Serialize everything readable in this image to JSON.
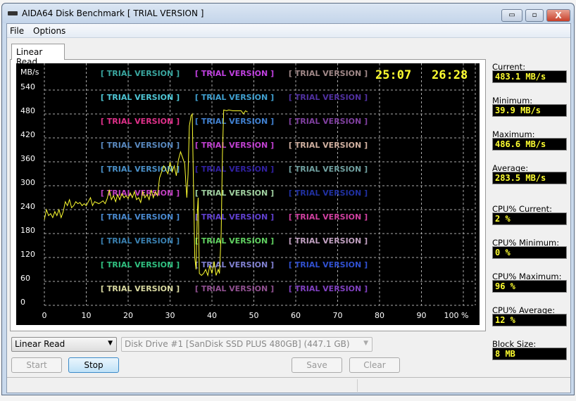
{
  "window": {
    "title": "AIDA64 Disk Benchmark  [ TRIAL VERSION ]",
    "minimize": "▭",
    "maximize": "▫",
    "close": "X"
  },
  "menu": [
    "File",
    "Options"
  ],
  "tab": "Linear Read",
  "chart": {
    "times": [
      "25:07",
      "26:28"
    ],
    "watermark": "[ TRIAL VERSION ]",
    "watermark_colors": [
      [
        "#3aa7a0",
        "#c040e0",
        "#a08888"
      ],
      [
        "#4fc7d6",
        "#40a0d0",
        "#5030a0"
      ],
      [
        "#e0308a",
        "#4080d0",
        "#8040a0"
      ],
      [
        "#5a8ac0",
        "#c040d0",
        "#d0b0a0"
      ],
      [
        "#4a90c8",
        "#3020a0",
        "#70a0a0"
      ],
      [
        "#c040c0",
        "#a0d0a0",
        "#2030a0"
      ],
      [
        "#4a8ad0",
        "#6040d0",
        "#d040a0"
      ],
      [
        "#3a80b0",
        "#60d060",
        "#c0a0c0"
      ],
      [
        "#30c080",
        "#8080d0",
        "#3050d0"
      ],
      [
        "#d8d8a0",
        "#905090",
        "#8040c0"
      ]
    ]
  },
  "chart_data": {
    "type": "line",
    "ylabel": "MB/s",
    "xlabel": "%",
    "xlim": [
      0,
      100
    ],
    "ylim": [
      0,
      540
    ],
    "x_ticks": [
      "0",
      "10",
      "20",
      "30",
      "40",
      "50",
      "60",
      "70",
      "80",
      "90",
      "100 %"
    ],
    "y_ticks": [
      "0",
      "60",
      "120",
      "180",
      "240",
      "300",
      "360",
      "420",
      "480",
      "540"
    ],
    "grid": true,
    "line_color": "#ffff30",
    "series": [
      {
        "x": [
          0,
          0.5,
          1,
          1.5,
          2,
          2.5,
          3,
          3.5,
          4,
          4.5,
          5,
          5.5,
          6,
          6.5,
          7,
          7.5,
          8,
          8.5,
          9,
          9.5,
          10,
          10.5,
          11,
          11.5,
          12,
          13,
          14,
          14.5,
          15,
          15.5,
          16,
          16.5,
          17,
          17.5,
          18,
          18.5,
          19,
          19.5,
          20,
          20.5,
          21,
          21.5,
          22,
          22.5,
          23,
          23.5,
          24,
          24.5,
          25,
          25.5,
          26,
          26.5,
          27,
          27.5,
          28,
          28.5,
          29,
          29.5,
          30,
          30.5,
          31,
          31.5,
          32,
          32.5,
          33,
          33.5,
          34,
          34.3,
          34.6,
          35,
          35.3,
          35.6,
          35.9,
          36.2,
          36.5,
          36.7,
          37,
          37.5,
          38,
          38.5,
          39,
          39.5,
          40,
          40.5,
          41,
          41.5,
          41.8,
          42.2,
          42.5,
          42.8,
          43.5,
          44,
          45,
          46,
          47,
          47.5,
          48,
          48.5
        ],
        "y": [
          215,
          240,
          225,
          230,
          220,
          235,
          225,
          240,
          220,
          235,
          260,
          250,
          265,
          245,
          250,
          260,
          255,
          258,
          250,
          255,
          250,
          260,
          270,
          250,
          260,
          255,
          262,
          255,
          268,
          290,
          265,
          275,
          260,
          278,
          265,
          280,
          270,
          275,
          268,
          282,
          270,
          285,
          265,
          270,
          258,
          285,
          270,
          278,
          265,
          290,
          270,
          285,
          275,
          320,
          335,
          350,
          340,
          330,
          360,
          335,
          350,
          325,
          365,
          385,
          370,
          355,
          270,
          330,
          450,
          475,
          480,
          300,
          120,
          90,
          230,
          270,
          80,
          75,
          80,
          90,
          75,
          100,
          80,
          110,
          75,
          90,
          80,
          180,
          380,
          490,
          488,
          490,
          488,
          488,
          488,
          480,
          488,
          485
        ]
      }
    ]
  },
  "stats": [
    {
      "label": "Current:",
      "value": "483.1 MB/s"
    },
    {
      "label": "Minimum:",
      "value": "39.9 MB/s"
    },
    {
      "label": "Maximum:",
      "value": "486.6 MB/s"
    },
    {
      "label": "Average:",
      "value": "283.5 MB/s"
    },
    {
      "label": "CPU% Current:",
      "value": "2 %"
    },
    {
      "label": "CPU% Minimum:",
      "value": "0 %"
    },
    {
      "label": "CPU% Maximum:",
      "value": "96 %"
    },
    {
      "label": "CPU% Average:",
      "value": "12 %"
    },
    {
      "label": "Block Size:",
      "value": "8 MB"
    }
  ],
  "controls": {
    "test_select": "Linear Read",
    "drive_select": "Disk Drive #1  [SanDisk SSD PLUS 480GB]  (447.1 GB)",
    "start": "Start",
    "stop": "Stop",
    "save": "Save",
    "clear": "Clear"
  }
}
